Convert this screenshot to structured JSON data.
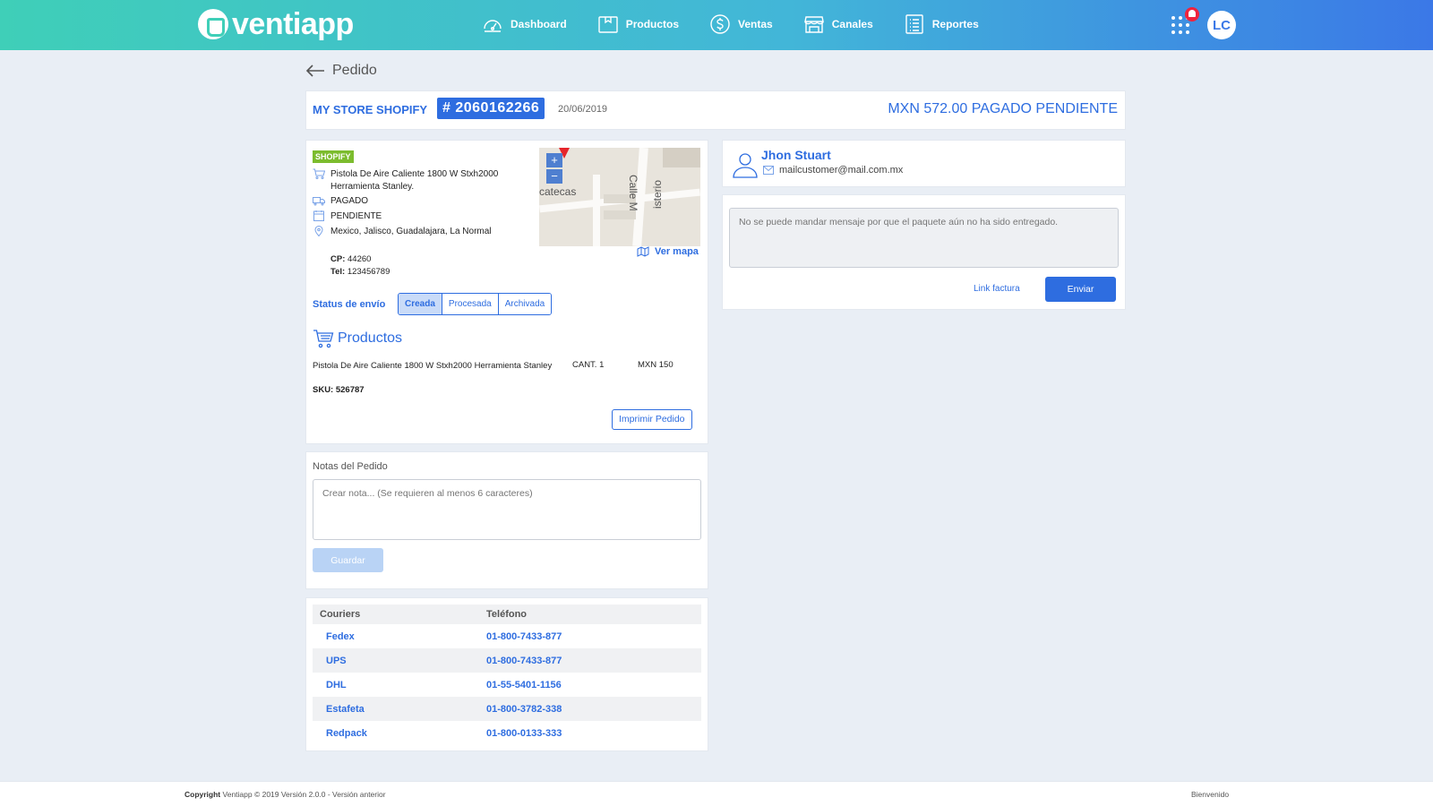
{
  "app": {
    "logo_text": "ventiapp"
  },
  "nav": {
    "items": [
      {
        "label": "Dashboard",
        "icon": "speedometer-icon"
      },
      {
        "label": "Productos",
        "icon": "box-icon"
      },
      {
        "label": "Ventas",
        "icon": "dollar-icon"
      },
      {
        "label": "Canales",
        "icon": "store-icon"
      },
      {
        "label": "Reportes",
        "icon": "list-icon"
      }
    ],
    "avatar_initials": "LC"
  },
  "page": {
    "back_label": "Pedido"
  },
  "order": {
    "store": "MY STORE SHOPIFY",
    "id": "# 2060162266",
    "date": "20/06/2019",
    "total": "MXN 572.00 PAGADO PENDIENTE"
  },
  "detail": {
    "channel_badge": "SHOPIFY",
    "product_line": "Pistola De Aire Caliente 1800 W Stxh2000 Herramienta Stanley.",
    "payment_status": "PAGADO",
    "fulfillment_status": "PENDIENTE",
    "address": "Mexico, Jalisco, Guadalajara, La Normal",
    "cp_label": "CP:",
    "cp_value": "44260",
    "tel_label": "Tel:",
    "tel_value": "123456789",
    "map_link": "Ver mapa",
    "map_text_1": "catecas",
    "map_text_2": "Calle M",
    "map_text_3": "isterio"
  },
  "shipping_status": {
    "label": "Status de envío",
    "options": [
      "Creada",
      "Procesada",
      "Archivada"
    ],
    "selected": "Creada"
  },
  "products": {
    "title": "Productos",
    "items": [
      {
        "name": "Pistola De Aire Caliente 1800 W Stxh2000 Herramienta Stanley",
        "sku": "SKU: 526787",
        "qty": "CANT. 1",
        "price": "MXN 150"
      }
    ],
    "print_button": "Imprimir Pedido"
  },
  "notes": {
    "title": "Notas del Pedido",
    "placeholder": "Crear nota... (Se requieren al menos 6 caracteres)",
    "save_button": "Guardar"
  },
  "couriers": {
    "headers": [
      "Couriers",
      "Teléfono"
    ],
    "rows": [
      {
        "name": "Fedex",
        "phone": "01-800-7433-877"
      },
      {
        "name": "UPS",
        "phone": "01-800-7433-877"
      },
      {
        "name": "DHL",
        "phone": "01-55-5401-1156"
      },
      {
        "name": "Estafeta",
        "phone": "01-800-3782-338"
      },
      {
        "name": "Redpack",
        "phone": "01-800-0133-333"
      }
    ]
  },
  "customer": {
    "name": "Jhon Stuart",
    "email": "mailcustomer@mail.com.mx"
  },
  "message": {
    "placeholder": "No se puede mandar mensaje por que el paquete aún no ha sido entregado.",
    "invoice_link": "Link factura",
    "send_button": "Enviar"
  },
  "footer": {
    "copyright_label": "Copyright",
    "copyright_text": "Ventiapp © 2019 Versión 2.0.0 - Versión anterior",
    "right_text": "Bienvenido"
  },
  "colors": {
    "accent": "#2e6de0",
    "gradient_start": "#3fcfb8",
    "gradient_end": "#3b78e7",
    "shopify_badge": "#7cbc2e",
    "notification": "#f0233d"
  }
}
